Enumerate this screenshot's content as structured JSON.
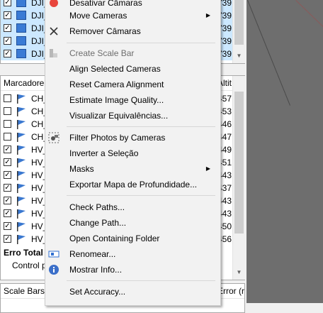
{
  "cameras_list": {
    "rows": [
      {
        "name": "DJI_",
        "value": "739."
      },
      {
        "name": "DJI_",
        "value": "739."
      },
      {
        "name": "DJI_",
        "value": "739."
      },
      {
        "name": "DJI_",
        "value": "739."
      },
      {
        "name": "DJI_",
        "value": "739."
      }
    ]
  },
  "markers_list": {
    "header_name": "Marcadore",
    "header_alt": "Altit",
    "rows": [
      {
        "name": "CH_",
        "value": "457.",
        "checked": false
      },
      {
        "name": "CH_",
        "value": "453.",
        "checked": false
      },
      {
        "name": "CH_",
        "value": "446.",
        "checked": false
      },
      {
        "name": "CH_",
        "value": "447.",
        "checked": false
      },
      {
        "name": "HV_",
        "value": "449.",
        "checked": true
      },
      {
        "name": "HV_",
        "value": "451.",
        "checked": true
      },
      {
        "name": "HV_",
        "value": "443.",
        "checked": true
      },
      {
        "name": "HV_",
        "value": "437.",
        "checked": true
      },
      {
        "name": "HV_",
        "value": "443.",
        "checked": true
      },
      {
        "name": "HV_",
        "value": "443.",
        "checked": true
      },
      {
        "name": "HV_",
        "value": "450.",
        "checked": true
      },
      {
        "name": "HV_",
        "value": "456.",
        "checked": true
      }
    ],
    "total_label": "Erro Total",
    "control_label": "Control p"
  },
  "scale_bars": {
    "header": "Scale Bars",
    "error_header": "Error (r"
  },
  "context_menu": {
    "items": [
      {
        "id": "desativar",
        "label": "Desativar Câmaras",
        "icon": "red-dot-icon",
        "enabled": true
      },
      {
        "id": "move",
        "label": "Move Cameras",
        "submenu": true,
        "enabled": true
      },
      {
        "id": "remover",
        "label": "Remover Câmaras",
        "icon": "close-icon",
        "enabled": true
      },
      {
        "id": "scalebar",
        "label": "Create Scale Bar",
        "icon": "scale-bar-icon",
        "enabled": false
      },
      {
        "id": "align",
        "label": "Align Selected Cameras",
        "enabled": true
      },
      {
        "id": "reset",
        "label": "Reset Camera Alignment",
        "enabled": true
      },
      {
        "id": "estimate",
        "label": "Estimate Image Quality...",
        "enabled": true
      },
      {
        "id": "visualizar",
        "label": "Visualizar Equivalências...",
        "enabled": true
      },
      {
        "id": "filter",
        "label": "Filter Photos by Cameras",
        "icon": "filter-photos-icon",
        "enabled": true
      },
      {
        "id": "inverter",
        "label": "Inverter a Seleção",
        "enabled": true
      },
      {
        "id": "masks",
        "label": "Masks",
        "submenu": true,
        "enabled": true
      },
      {
        "id": "exportar",
        "label": "Exportar Mapa de Profundidade...",
        "enabled": true
      },
      {
        "id": "check",
        "label": "Check Paths...",
        "enabled": true
      },
      {
        "id": "change",
        "label": "Change Path...",
        "enabled": true
      },
      {
        "id": "open",
        "label": "Open Containing Folder",
        "enabled": true
      },
      {
        "id": "renomear",
        "label": "Renomear...",
        "icon": "rename-icon",
        "enabled": true
      },
      {
        "id": "info",
        "label": "Mostrar Info...",
        "icon": "info-icon",
        "enabled": true
      },
      {
        "id": "accuracy",
        "label": "Set Accuracy...",
        "enabled": true
      }
    ]
  }
}
